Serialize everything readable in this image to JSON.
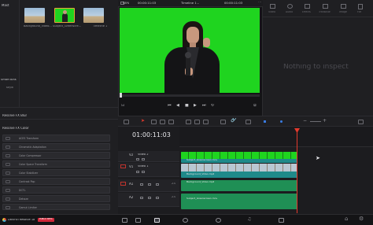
{
  "media_pool": {
    "side_label": "Mast",
    "smart_bins": "Smart Bins",
    "smart_bins_sub": "Keyw",
    "clips": [
      {
        "label": "Background_Video..."
      },
      {
        "label": "Subject_Greenscre..."
      },
      {
        "label": "Timeline 1"
      }
    ]
  },
  "viewer": {
    "zoom": "58%",
    "source_timecode": "00:00:11:03",
    "timeline_name": "Timeline 1",
    "program_timecode": "00:00:11:03"
  },
  "inspector": {
    "tabs": [
      "Video",
      "Audio",
      "Effects",
      "Transition",
      "Image",
      "File"
    ],
    "empty_message": "Nothing to inspect"
  },
  "effects": {
    "header": "Resolve FX Blur",
    "section": "Resolve FX Color",
    "items": [
      "ACES Transform",
      "Chromatic Adaptation",
      "Color Compressor",
      "Color Space Transform",
      "Color Stabilizer",
      "Contrast Pop",
      "DCTL",
      "Dehaze",
      "Gamut Limiter",
      "Gamut Mapping"
    ]
  },
  "timeline": {
    "timecode": "01:00:11:03",
    "tracks": [
      {
        "id": "V2",
        "name": "Video 2"
      },
      {
        "id": "V1",
        "name": "Video 1"
      },
      {
        "id": "A1",
        "level": "2.0"
      },
      {
        "id": "A2",
        "level": "2.0"
      }
    ],
    "clips": {
      "v2": "Subject_Greenscreen.mov",
      "v1": "Background_Video.mp4",
      "a1": "Background_Video.mp4",
      "a2": "Subject_Greenscreen.mov"
    }
  },
  "footer": {
    "app_name": "DaVinci Resolve 18",
    "badge": "PUBLIC BETA"
  },
  "colors": {
    "green_screen": "#1fd41f",
    "video_clip": "#1f8a8a",
    "audio_clip": "#1f8f55",
    "playhead": "#e53a2d",
    "badge": "#d1283a"
  }
}
